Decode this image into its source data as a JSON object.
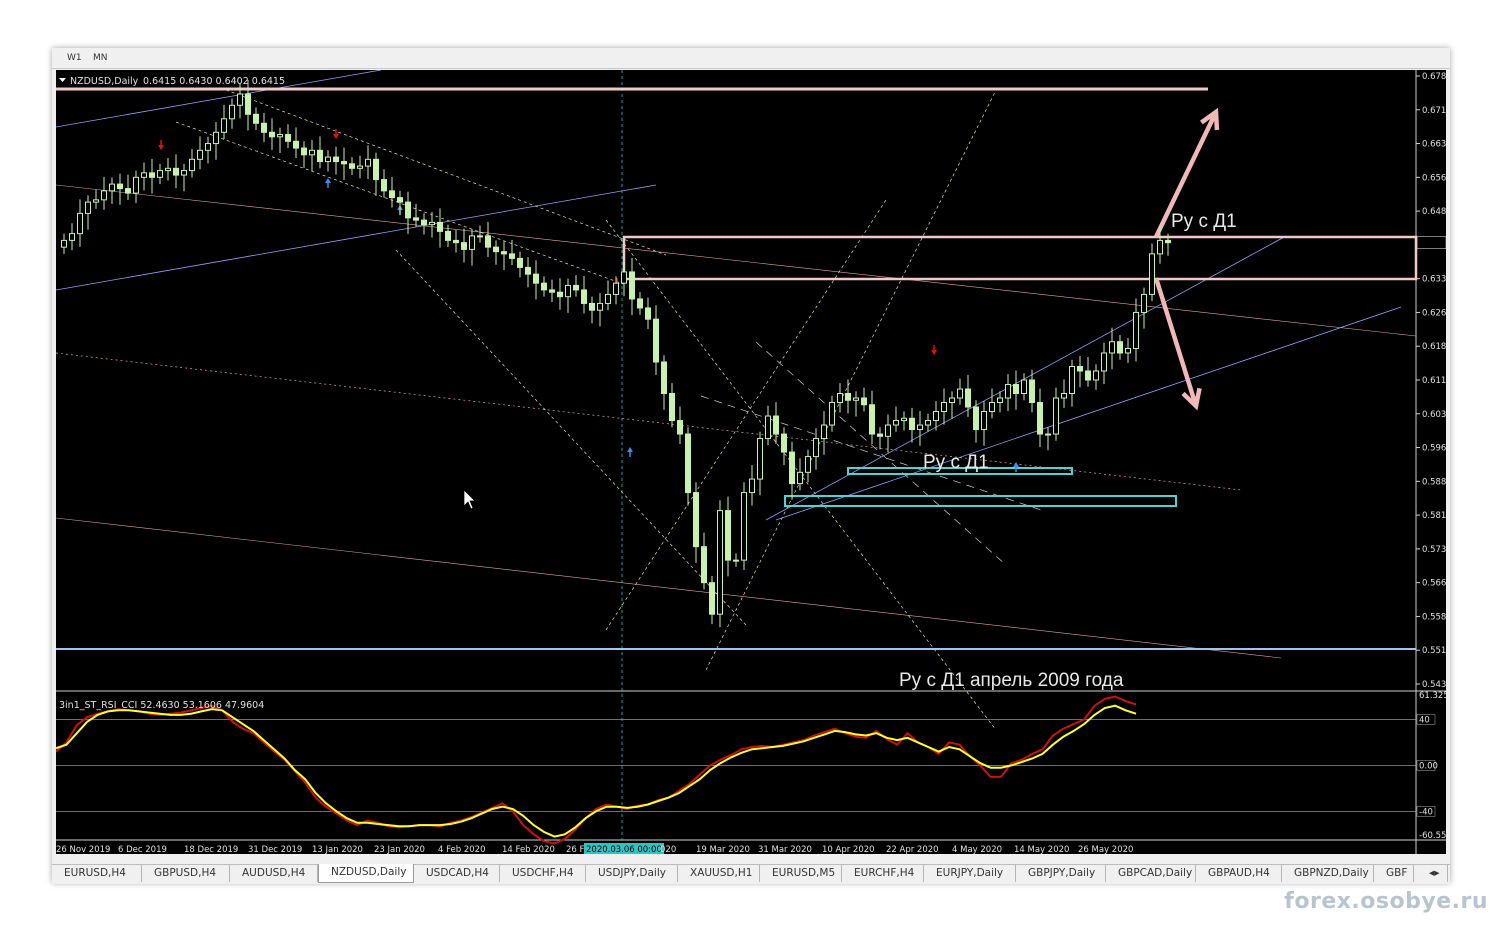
{
  "timeframes": [
    "W1",
    "MN"
  ],
  "header": {
    "symbol": "NZDUSD,Daily",
    "values": "0.6415 0.6430 0.6402 0.6415"
  },
  "indicator": {
    "label": "3in1_ST_RSI_CCI 52.4630 53.1606 47.9604",
    "scale": [
      "61.3251",
      "40",
      "0.00",
      "-40",
      "-60.555"
    ]
  },
  "price_scale": [
    "0.6785",
    "0.6710",
    "0.6635",
    "0.6560",
    "0.6485",
    "0.6415",
    "0.6335",
    "0.6260",
    "0.6185",
    "0.6110",
    "0.6035",
    "0.5960",
    "0.5885",
    "0.5810",
    "0.5735",
    "0.5660",
    "0.5585",
    "0.5510",
    "0.5435"
  ],
  "current_price": "0.6415",
  "date_axis": [
    "26 Nov 2019",
    "6 Dec 2019",
    "18 Dec 2019",
    "31 Dec 2019",
    "13 Jan 2020",
    "23 Jan 2020",
    "4 Feb 2020",
    "14 Feb 2020",
    "26 F",
    "2020.03.06 00:00",
    "020",
    "19 Mar 2020",
    "31 Mar 2020",
    "10 Apr 2020",
    "22 Apr 2020",
    "4 May 2020",
    "14 May 2020",
    "26 May 2020"
  ],
  "annotations": {
    "top_label": "Ру с Д1",
    "mid_label": "Ру с Д1",
    "bottom_label": "Ру с Д1 апрель 2009 года"
  },
  "tabs": [
    "EURUSD,H4",
    "GBPUSD,H4",
    "AUDUSD,H4",
    "NZDUSD,Daily",
    "USDCAD,H4",
    "USDCHF,H4",
    "USDJPY,Daily",
    "XAUUSD,H1",
    "EURUSD,M5",
    "EURCHF,H4",
    "EURJPY,Daily",
    "GBPJPY,Daily",
    "GBPCAD,Daily",
    "GBPAUD,H4",
    "GBPNZD,Daily",
    "GBF"
  ],
  "active_tab": "NZDUSD,Daily",
  "watermark": "forex.osobye.ru",
  "chart_data": {
    "type": "candlestick",
    "symbol": "NZDUSD",
    "timeframe": "Daily",
    "ylim": [
      0.5435,
      0.6785
    ],
    "close": [
      0.642,
      0.6435,
      0.648,
      0.6505,
      0.651,
      0.653,
      0.6545,
      0.6535,
      0.6525,
      0.656,
      0.657,
      0.656,
      0.6575,
      0.658,
      0.6565,
      0.6575,
      0.66,
      0.662,
      0.6635,
      0.666,
      0.669,
      0.672,
      0.6745,
      0.67,
      0.668,
      0.666,
      0.665,
      0.6655,
      0.664,
      0.6625,
      0.661,
      0.662,
      0.6595,
      0.6605,
      0.6595,
      0.659,
      0.658,
      0.6585,
      0.66,
      0.6555,
      0.653,
      0.6515,
      0.6505,
      0.647,
      0.6465,
      0.6455,
      0.646,
      0.644,
      0.642,
      0.6415,
      0.64,
      0.643,
      0.643,
      0.6405,
      0.6395,
      0.639,
      0.638,
      0.636,
      0.6345,
      0.6325,
      0.631,
      0.6305,
      0.6295,
      0.632,
      0.631,
      0.628,
      0.6265,
      0.628,
      0.63,
      0.6325,
      0.635,
      0.629,
      0.627,
      0.6245,
      0.615,
      0.608,
      0.602,
      0.599,
      0.586,
      0.574,
      0.566,
      0.559,
      0.582,
      0.571,
      0.571,
      0.586,
      0.589,
      0.598,
      0.603,
      0.599,
      0.595,
      0.588,
      0.5905,
      0.594,
      0.598,
      0.601,
      0.606,
      0.608,
      0.6065,
      0.607,
      0.6055,
      0.599,
      0.5985,
      0.601,
      0.602,
      0.6025,
      0.6,
      0.601,
      0.602,
      0.604,
      0.606,
      0.607,
      0.609,
      0.605,
      0.6,
      0.604,
      0.606,
      0.607,
      0.61,
      0.608,
      0.611,
      0.606,
      0.599,
      0.599,
      0.607,
      0.608,
      0.614,
      0.613,
      0.611,
      0.613,
      0.617,
      0.6195,
      0.617,
      0.618,
      0.626,
      0.63,
      0.639,
      0.642,
      0.6415
    ],
    "series": [
      {
        "name": "Stochastic",
        "color": "#cc1111",
        "values": [
          12,
          20,
          35,
          42,
          45,
          47,
          49,
          48,
          47,
          45,
          44,
          45,
          46,
          48,
          50,
          52,
          48,
          38,
          32,
          28,
          20,
          12,
          5,
          -5,
          -15,
          -28,
          -36,
          -42,
          -48,
          -52,
          -48,
          -50,
          -53,
          -54,
          -53,
          -52,
          -52,
          -53,
          -50,
          -48,
          -45,
          -41,
          -37,
          -33,
          -40,
          -52,
          -60,
          -66,
          -68,
          -64,
          -56,
          -46,
          -38,
          -34,
          -36,
          -38,
          -35,
          -34,
          -30,
          -28,
          -22,
          -16,
          -8,
          0,
          5,
          9,
          14,
          16,
          17,
          16,
          18,
          20,
          22,
          26,
          29,
          32,
          28,
          25,
          24,
          30,
          23,
          18,
          28,
          20,
          16,
          10,
          20,
          18,
          8,
          0,
          -10,
          -10,
          2,
          5,
          10,
          14,
          26,
          32,
          36,
          40,
          52,
          58,
          60,
          56,
          53
        ]
      },
      {
        "name": "RSI",
        "color": "#ffff33",
        "values": [
          15,
          18,
          28,
          38,
          44,
          47,
          48,
          48,
          47,
          46,
          45,
          44,
          44,
          45,
          47,
          49,
          48,
          42,
          36,
          30,
          22,
          14,
          6,
          -4,
          -12,
          -24,
          -33,
          -40,
          -46,
          -50,
          -50,
          -51,
          -52,
          -53,
          -53,
          -52,
          -52,
          -52,
          -51,
          -49,
          -46,
          -42,
          -38,
          -36,
          -38,
          -44,
          -52,
          -58,
          -62,
          -60,
          -54,
          -46,
          -40,
          -36,
          -36,
          -37,
          -36,
          -34,
          -31,
          -28,
          -24,
          -18,
          -12,
          -4,
          2,
          7,
          11,
          14,
          15,
          16,
          17,
          19,
          21,
          24,
          27,
          30,
          29,
          27,
          26,
          28,
          24,
          22,
          24,
          20,
          16,
          12,
          16,
          14,
          8,
          2,
          -2,
          -2,
          0,
          3,
          6,
          10,
          18,
          25,
          30,
          36,
          44,
          50,
          52,
          48,
          45
        ]
      }
    ]
  }
}
